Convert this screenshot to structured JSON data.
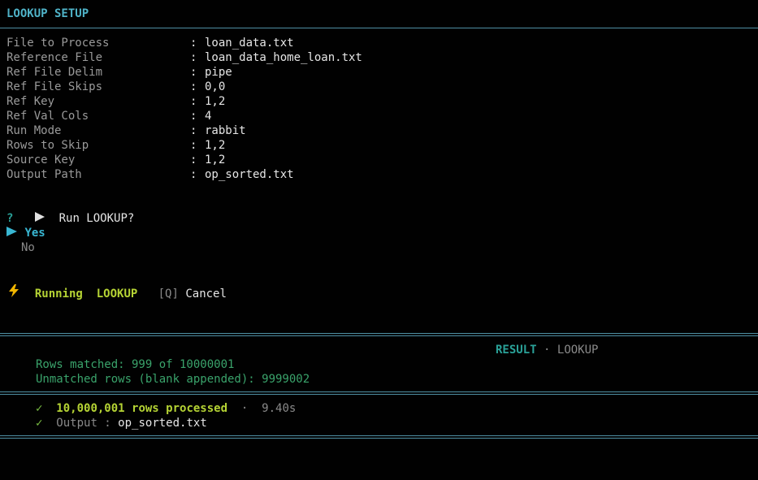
{
  "header": {
    "title": "LOOKUP SETUP"
  },
  "config": [
    {
      "label": "File to Process",
      "value": "loan_data.txt"
    },
    {
      "label": "Reference File",
      "value": "loan_data_home_loan.txt"
    },
    {
      "label": "Ref File Delim",
      "value": "pipe"
    },
    {
      "label": "Ref File Skips",
      "value": "0,0"
    },
    {
      "label": "Ref Key",
      "value": "1,2"
    },
    {
      "label": "Ref Val Cols",
      "value": "4"
    },
    {
      "label": "Run Mode",
      "value": "rabbit"
    },
    {
      "label": "Rows to Skip",
      "value": "1,2"
    },
    {
      "label": "Source Key",
      "value": "1,2"
    },
    {
      "label": "Output Path",
      "value": "op_sorted.txt"
    }
  ],
  "separator": ":",
  "prompt": {
    "mark": "?",
    "arrow_icon": "play-icon",
    "question": "Run LOOKUP?",
    "options": [
      {
        "label": "Yes",
        "selected": true
      },
      {
        "label": "No",
        "selected": false
      }
    ]
  },
  "running": {
    "icon": "lightning-icon",
    "status": "Running",
    "task": "LOOKUP",
    "cancel_key": "[Q]",
    "cancel_label": "Cancel"
  },
  "result": {
    "label": "RESULT",
    "dot": "·",
    "name": "LOOKUP",
    "matched": "Rows matched: 999 of 10000001",
    "unmatched": "Unmatched rows (blank appended): 9999002"
  },
  "summary": {
    "check": "✓",
    "processed": "10,000,001 rows processed",
    "dot": "·",
    "elapsed": "9.40s",
    "output_label": "Output :",
    "output_value": "op_sorted.txt"
  },
  "colors": {
    "background": "#010101",
    "title": "#4fb3c8",
    "accent_lime": "#b5d334",
    "accent_green": "#3aa36b",
    "accent_teal": "#2aa198",
    "rule": "#4e8fa3"
  }
}
